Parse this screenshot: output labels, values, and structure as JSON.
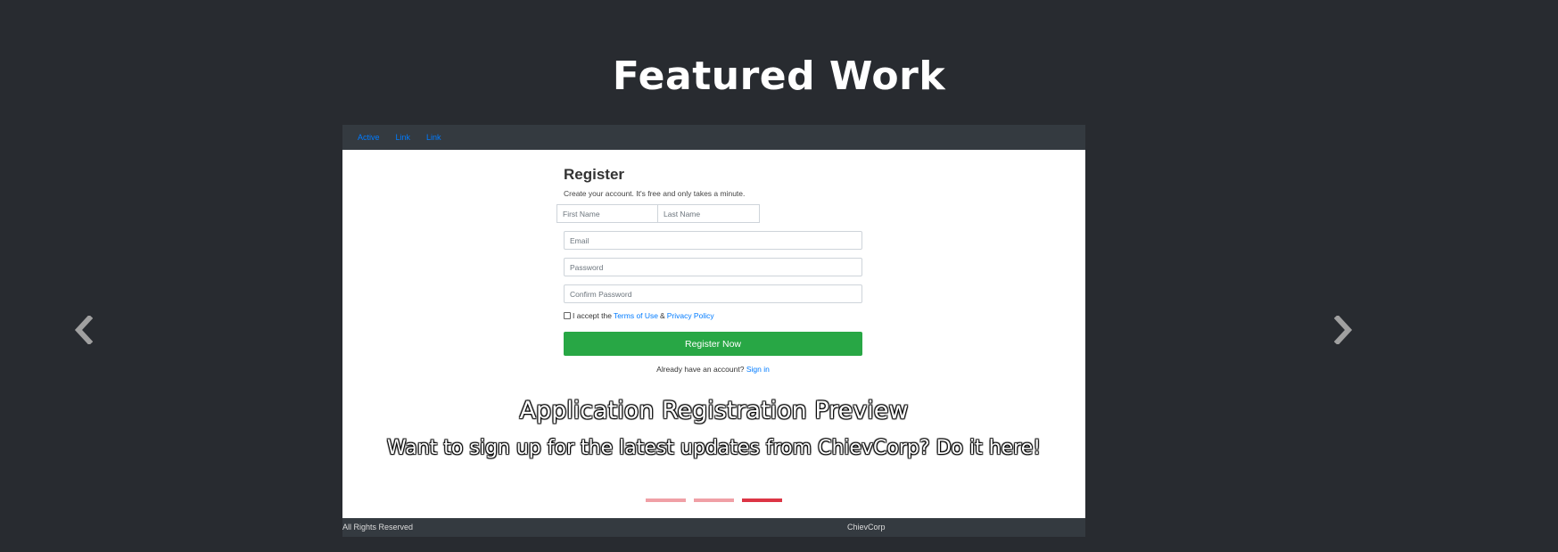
{
  "section": {
    "title": "Featured Work"
  },
  "preview": {
    "nav": [
      "Active",
      "Link",
      "Link"
    ],
    "register": {
      "title": "Register",
      "subtitle": "Create your account. It's free and only takes a minute.",
      "first_name_placeholder": "First Name",
      "last_name_placeholder": "Last Name",
      "email_placeholder": "Email",
      "password_placeholder": "Password",
      "confirm_placeholder": "Confirm Password",
      "terms_prefix": "I accept the",
      "terms_link": "Terms of Use",
      "terms_amp": "&",
      "privacy_link": "Privacy Policy",
      "button": "Register Now",
      "signin_prefix": "Already have an account?",
      "signin_link": "Sign in"
    }
  },
  "caption": {
    "title": "Application Registration Preview",
    "text": "Want to sign up for the latest updates from ChievCorp? Do it here!"
  },
  "carousel": {
    "indicators": 3,
    "active_index": 2,
    "prev_icon": "chevron-left-icon",
    "next_icon": "chevron-right-icon"
  },
  "footer": {
    "left": "All Rights Reserved",
    "right": "ChievCorp"
  },
  "colors": {
    "background": "#282b30",
    "button_green": "#28a745",
    "link_blue": "#007bff",
    "indicator_active": "#dc3545",
    "indicator_inactive": "#f0a0a6"
  }
}
